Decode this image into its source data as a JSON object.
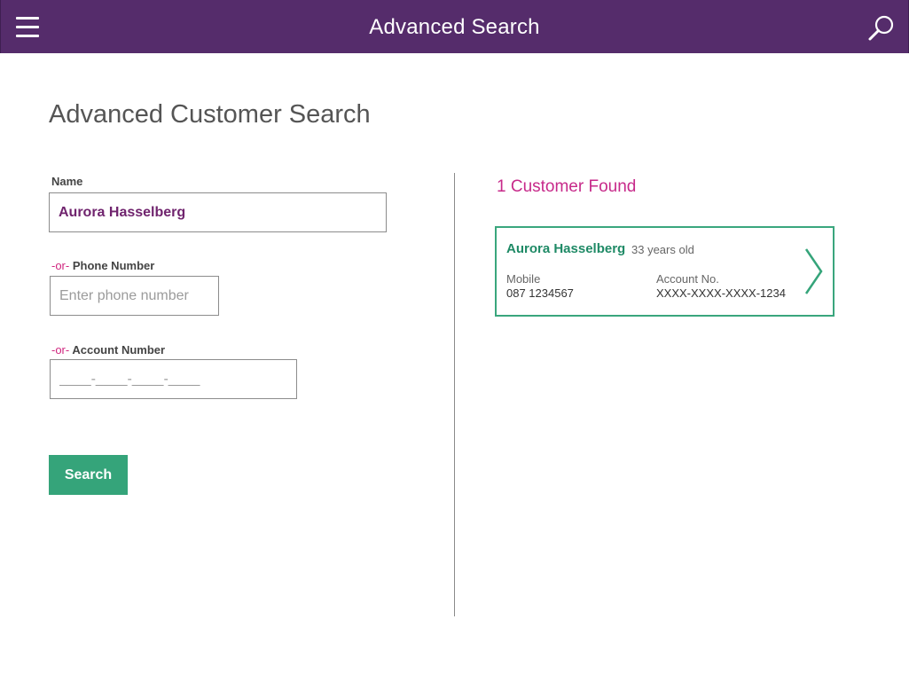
{
  "header": {
    "title": "Advanced Search"
  },
  "page": {
    "title": "Advanced Customer Search"
  },
  "form": {
    "name_label": "Name",
    "name_value": "Aurora Hasselberg",
    "or_text": "-or-",
    "phone_label": "Phone Number",
    "phone_placeholder": "Enter phone number",
    "account_label": "Account Number",
    "account_placeholder": "____-____-____-____",
    "search_button": "Search"
  },
  "results": {
    "count_text": "1 Customer Found",
    "items": [
      {
        "name": "Aurora Hasselberg",
        "age": "33 years old",
        "mobile_label": "Mobile",
        "mobile": "087 1234567",
        "account_label": "Account No.",
        "account": "XXXX-XXXX-XXXX-1234"
      }
    ]
  },
  "colors": {
    "header_bg": "#552c6b",
    "accent_green": "#35a47a",
    "accent_magenta": "#c72a8a",
    "name_purple": "#70246e"
  },
  "icons": {
    "menu": "menu-icon",
    "search": "search-icon",
    "chevron": "chevron-right-icon"
  }
}
